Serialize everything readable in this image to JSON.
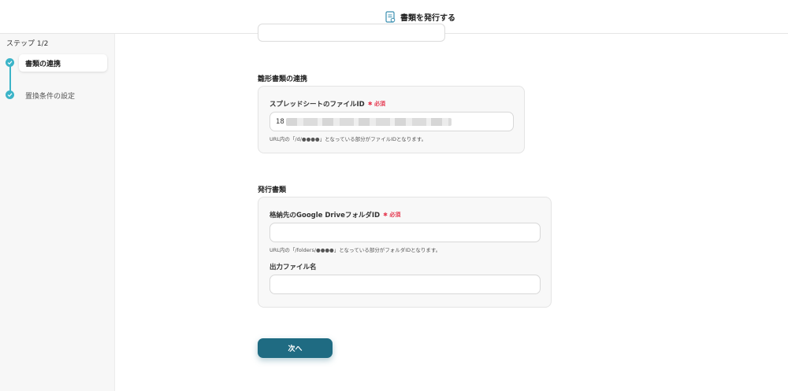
{
  "header": {
    "title": "書類を発行する",
    "icon": "document-icon"
  },
  "sidebar": {
    "step_label": "ステップ 1/2",
    "steps": [
      {
        "label": "書類の連携",
        "active": true
      },
      {
        "label": "置換条件の設定",
        "active": false
      }
    ]
  },
  "template_section": {
    "title": "雛形書類の連携",
    "spreadsheet_field": {
      "label": "スプレッドシートのファイルID",
      "required": "必須",
      "value_prefix": "18",
      "hint": "URL内の「/d/●●●●」となっている部分がファイルIDとなります。"
    }
  },
  "issue_section": {
    "title": "発行書類",
    "folder_field": {
      "label": "格納先のGoogle DriveフォルダID",
      "required": "必須",
      "value": "",
      "hint": "URL内の「/folders/●●●●」となっている部分がフォルダIDとなります。"
    },
    "filename_field": {
      "label": "出力ファイル名",
      "value": ""
    }
  },
  "footer": {
    "next_label": "次へ"
  },
  "colors": {
    "accent": "#3cb4c8",
    "button": "#1f6b82",
    "required": "#e53950"
  }
}
